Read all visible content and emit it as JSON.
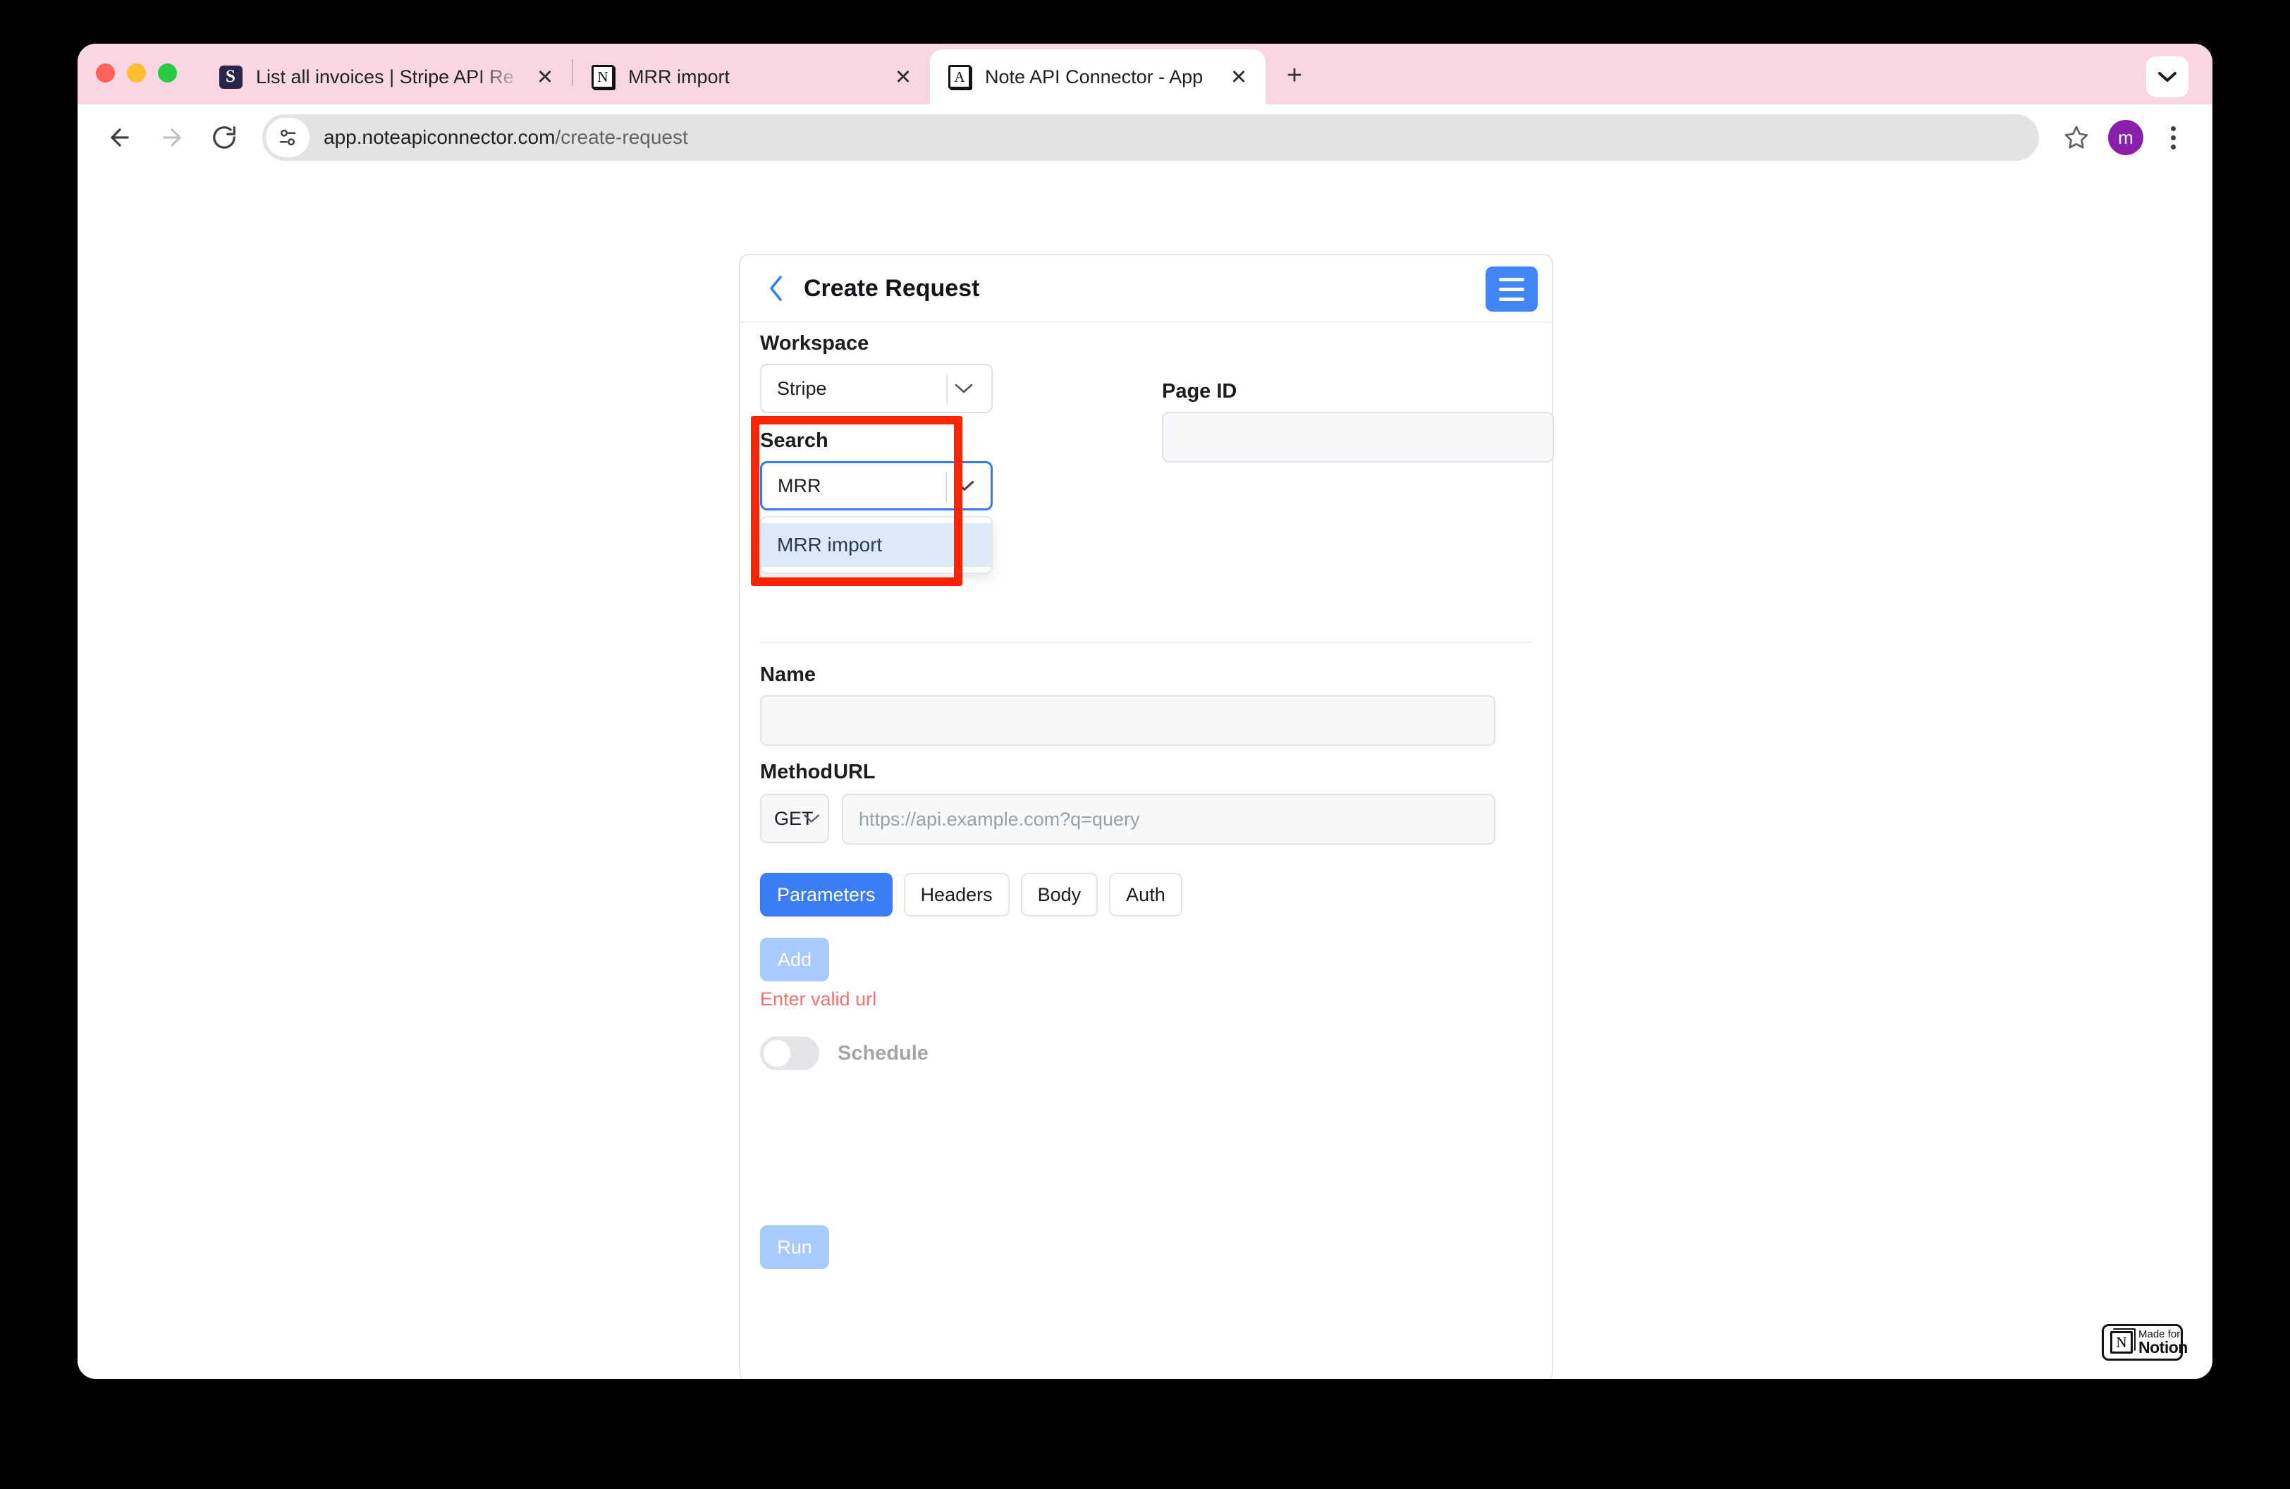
{
  "browser": {
    "tabs": [
      {
        "title": "List all invoices | Stripe API Re",
        "favicon": "stripe-icon",
        "favicon_letter": "S",
        "active": false,
        "close_label": "✕"
      },
      {
        "title": "MRR import",
        "favicon": "notion-icon",
        "favicon_letter": "N",
        "active": false,
        "close_label": "✕"
      },
      {
        "title": "Note API Connector - App",
        "favicon": "app-icon",
        "favicon_letter": "A",
        "active": true,
        "close_label": "✕"
      }
    ],
    "new_tab_label": "+",
    "tab_list_label": "∨",
    "toolbar": {
      "back_label": "←",
      "forward_label": "→",
      "reload_label": "⟳",
      "url_domain": "app.noteapiconnector.com",
      "url_path": "/create-request",
      "bookmark_label": "☆",
      "profile_initial": "m"
    }
  },
  "card": {
    "title": "Create Request",
    "back_label": "‹",
    "menu_name": "hamburger-menu"
  },
  "form": {
    "workspace": {
      "label": "Workspace",
      "value": "Stripe"
    },
    "search": {
      "label": "Search",
      "value": "MRR",
      "options": [
        "MRR import"
      ]
    },
    "page_id": {
      "label": "Page ID",
      "value": "",
      "placeholder": ""
    },
    "name": {
      "label": "Name",
      "value": "",
      "placeholder": ""
    },
    "method": {
      "label": "Method",
      "value": "GET"
    },
    "url": {
      "label": "URL",
      "value": "",
      "placeholder": "https://api.example.com?q=query"
    },
    "tabs": [
      {
        "label": "Parameters",
        "active": true
      },
      {
        "label": "Headers",
        "active": false
      },
      {
        "label": "Body",
        "active": false
      },
      {
        "label": "Auth",
        "active": false
      }
    ],
    "add_label": "Add",
    "error_text": "Enter valid url",
    "schedule": {
      "label": "Schedule",
      "enabled": false
    },
    "run_label": "Run"
  },
  "badge": {
    "made_for": "Made for",
    "brand": "Notion",
    "cube_letter": "N"
  },
  "colors": {
    "accent_blue": "#3b7df6",
    "annotation_red": "#fa2500",
    "error_red": "#f4706f",
    "tabstrip_pink": "#f8d7e3",
    "avatar_purple": "#8a1fab",
    "disabled_blue": "#a8cbfb",
    "option_highlight": "#dce9f9"
  }
}
